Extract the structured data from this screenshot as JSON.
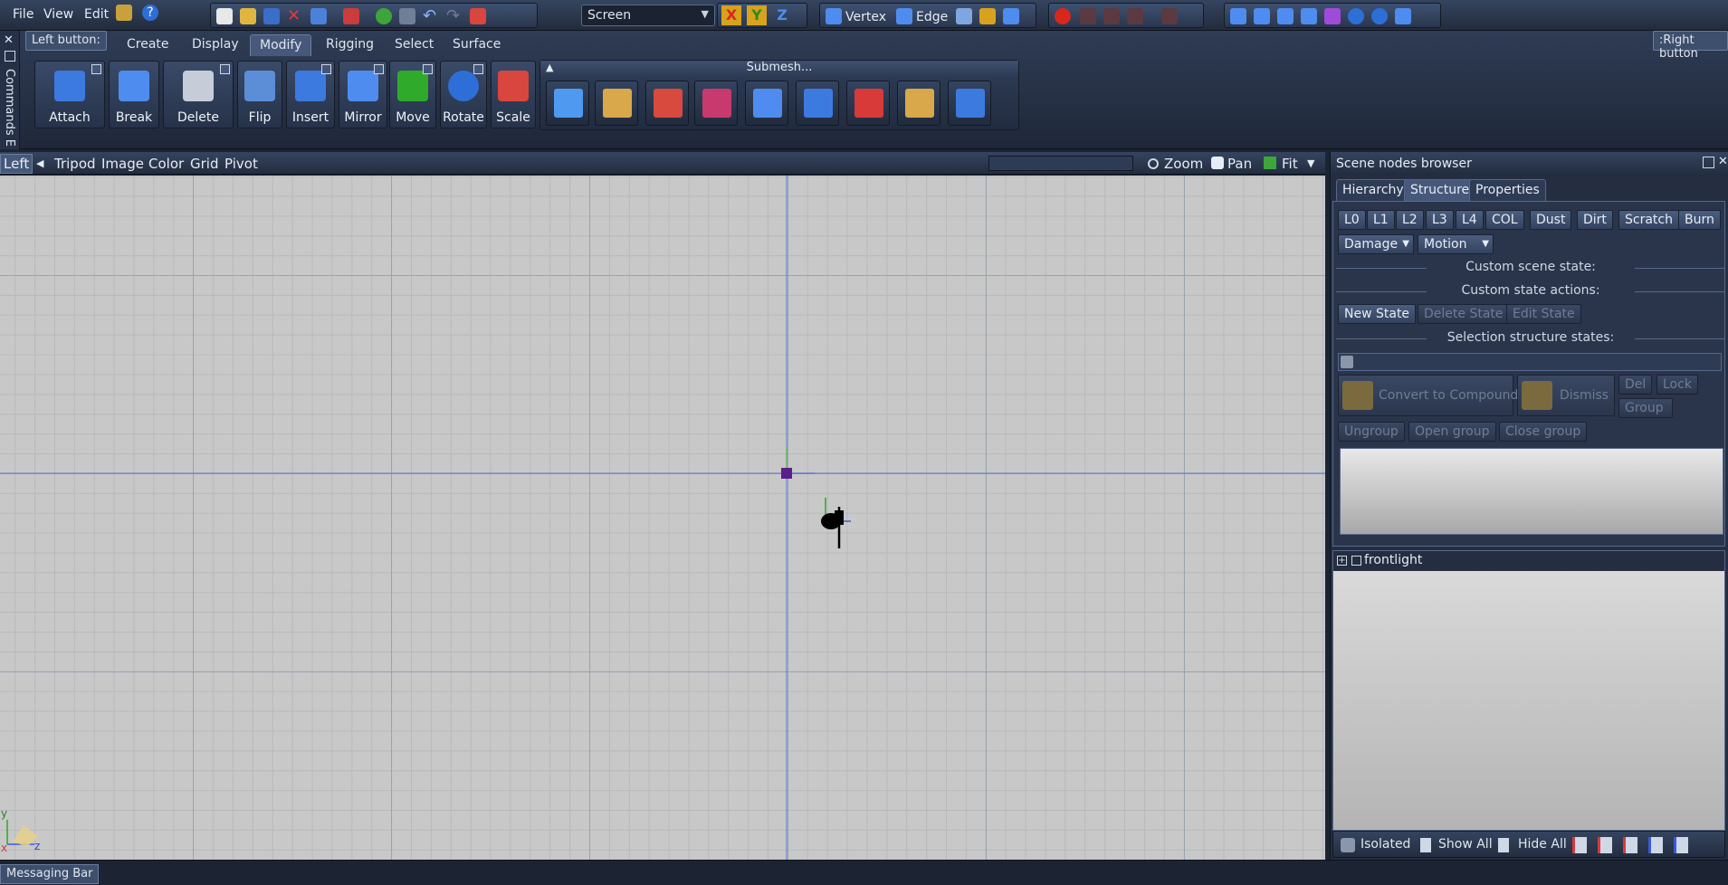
{
  "menu": {
    "file": "File",
    "view": "View",
    "edit": "Edit"
  },
  "toolbar": {
    "coord_space": "Screen",
    "axis_x": "X",
    "axis_y": "Y",
    "axis_z": "Z",
    "vertex": "Vertex",
    "edge": "Edge",
    "left_button": "Left button:",
    "right_button": ":Right button"
  },
  "commands_side": "Commands E",
  "ribbon": {
    "tabs": [
      "Create",
      "Display",
      "Modify",
      "Rigging",
      "Select",
      "Surface"
    ],
    "active_tab": "Modify",
    "tools": [
      "Attach",
      "Break",
      "Delete",
      "Flip",
      "Insert",
      "Mirror",
      "Move",
      "Rotate",
      "Scale"
    ],
    "submesh_label": "Submesh..."
  },
  "viewport": {
    "view_name": "Left",
    "menu": [
      "Tripod",
      "Image",
      "Color",
      "Grid",
      "Pivot"
    ],
    "zoom": "Zoom",
    "pan": "Pan",
    "fit": "Fit",
    "axis_y": "y",
    "axis_x": "x",
    "axis_z": "z"
  },
  "panel": {
    "title": "Scene nodes browser",
    "tabs": [
      "Hierarchy",
      "Structure",
      "Properties"
    ],
    "active_tab": "Structure",
    "lod_buttons": [
      "L0",
      "L1",
      "L2",
      "L3",
      "L4",
      "COL",
      "Dust",
      "Dirt",
      "Scratch",
      "Burn"
    ],
    "damage": "Damage",
    "motion": "Motion",
    "custom_scene_state": "Custom scene state:",
    "custom_state_actions": "Custom state actions:",
    "new_state": "New State",
    "delete_state": "Delete State",
    "edit_state": "Edit State",
    "selection_structure_states": "Selection structure states:",
    "convert_to_compound": "Convert to Compound",
    "dismiss": "Dismiss",
    "del": "Del",
    "lock": "Lock",
    "group": "Group",
    "ungroup": "Ungroup",
    "open_group": "Open group",
    "close_group": "Close group",
    "tree_item": "frontlight",
    "isolated": "Isolated",
    "show_all": "Show All",
    "hide_all": "Hide All"
  },
  "messaging_bar": "Messaging Bar"
}
